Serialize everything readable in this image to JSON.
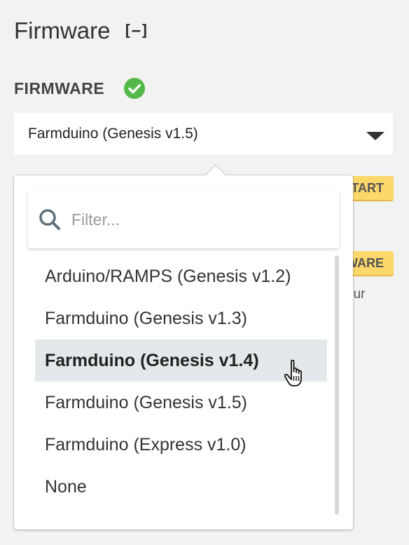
{
  "section": {
    "title": "Firmware",
    "collapse_label": "[−]"
  },
  "firmware": {
    "label": "FIRMWARE",
    "status": "ok",
    "selected": "Farmduino (Genesis v1.5)"
  },
  "background": {
    "badge_1": "START",
    "badge_2": "WARE",
    "text_fragment": "our"
  },
  "dropdown": {
    "filter_placeholder": "Filter...",
    "options": [
      "Arduino/RAMPS (Genesis v1.2)",
      "Farmduino (Genesis v1.3)",
      "Farmduino (Genesis v1.4)",
      "Farmduino (Genesis v1.5)",
      "Farmduino (Express v1.0)",
      "None"
    ],
    "hovered_option": "Farmduino (Genesis v1.4)"
  },
  "icons": {
    "status": "check-circle-icon",
    "search": "search-icon",
    "caret": "caret-down-icon",
    "cursor": "pointer-hand-icon"
  },
  "colors": {
    "status_green": "#55b94a",
    "badge_yellow": "#fcd76a",
    "hover_bg": "#e3e8ea",
    "search_icon": "#5e6f7a"
  }
}
